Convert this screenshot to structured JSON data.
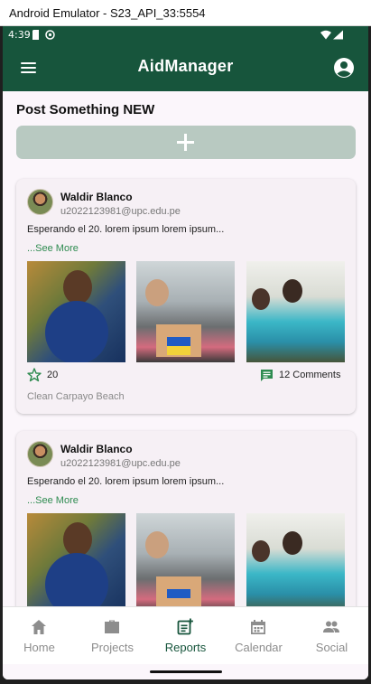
{
  "window": {
    "title": "Android Emulator - S23_API_33:5554"
  },
  "status_bar": {
    "time": "4:39"
  },
  "app_bar": {
    "title": "AidManager"
  },
  "composer": {
    "title": "Post Something NEW"
  },
  "posts": [
    {
      "author": "Waldir Blanco",
      "email": "u2022123981@upc.edu.pe",
      "text": "Esperando el 20. lorem ipsum lorem ipsum...",
      "see_more": "...See More",
      "likes": "20",
      "comments": "12 Comments",
      "location": "Clean Carpayo Beach"
    },
    {
      "author": "Waldir Blanco",
      "email": "u2022123981@upc.edu.pe",
      "text": "Esperando el 20. lorem ipsum lorem ipsum...",
      "see_more": "...See More"
    }
  ],
  "nav": [
    {
      "label": "Home",
      "icon": "home-icon"
    },
    {
      "label": "Projects",
      "icon": "briefcase-icon"
    },
    {
      "label": "Reports",
      "icon": "report-icon"
    },
    {
      "label": "Calendar",
      "icon": "calendar-icon"
    },
    {
      "label": "Social",
      "icon": "people-icon"
    }
  ],
  "colors": {
    "primary": "#17553c",
    "accent": "#2e8b50",
    "composer_button": "#b8c9c1"
  }
}
